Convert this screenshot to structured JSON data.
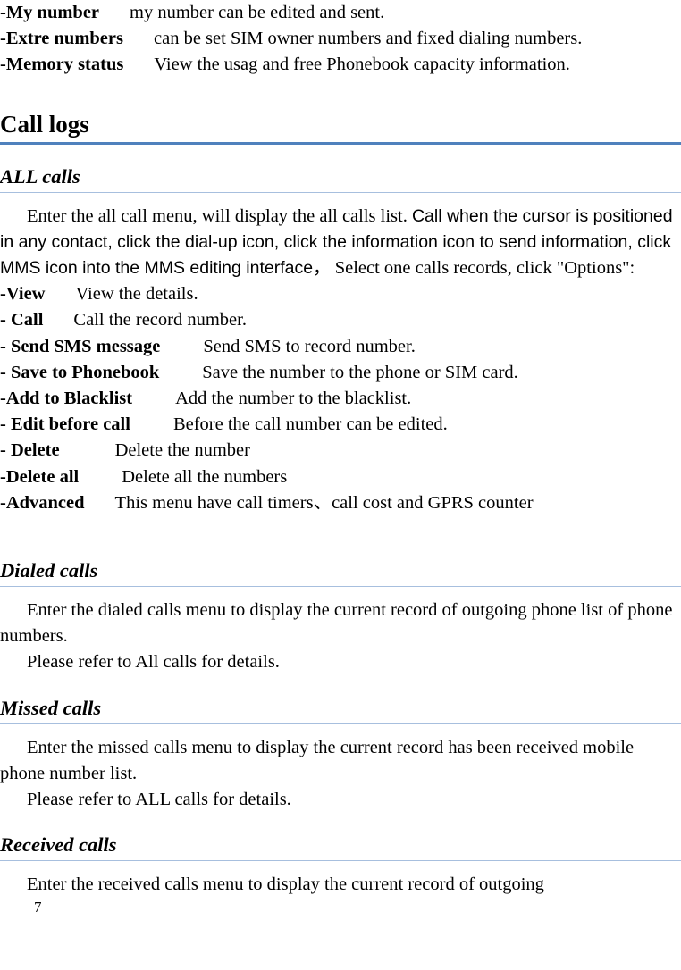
{
  "document": {
    "page_number": "7",
    "accent_color": "#4F81BD",
    "rule_color_light": "#A7BFDE"
  },
  "phonebook_tail": {
    "my_number": {
      "label": "-My number",
      "description": "my number can be edited and sent."
    },
    "extre_numbers": {
      "label": "-Extre numbers",
      "description": "can be set SIM owner numbers and fixed dialing numbers."
    },
    "memory_status": {
      "label": "-Memory status",
      "description": "View the usag and free Phonebook capacity information."
    }
  },
  "call_logs": {
    "heading": "Call logs",
    "all_calls": {
      "heading": "ALL calls",
      "intro_serif_1": "Enter the all call menu, will display the all calls list. ",
      "intro_sans": "Call when the cursor is positioned in any contact, click the dial-up icon, click the information icon to send information, click MMS icon into the MMS editing interface，",
      "intro_serif_2": " Select one calls records, click \"Options\":",
      "options": [
        {
          "label": "-View",
          "description": "View the details."
        },
        {
          "label": "- Call",
          "description": "Call the record number."
        },
        {
          "label": "- Send SMS message",
          "description": "Send SMS to record number."
        },
        {
          "label": "- Save to Phonebook",
          "description": "Save the number to the phone or SIM card."
        },
        {
          "label": "-Add to Blacklist",
          "description": "Add the number to the blacklist."
        },
        {
          "label": "- Edit before call",
          "description": "Before the call number can be edited."
        },
        {
          "label": "- Delete",
          "description": "Delete the number"
        },
        {
          "label": "-Delete all",
          "description": "Delete all the numbers"
        },
        {
          "label": "-Advanced",
          "description": "This menu have call timers、call cost and GPRS counter"
        }
      ]
    },
    "dialed_calls": {
      "heading": "Dialed calls",
      "body": "Enter the dialed calls menu to display the current record of outgoing phone list of phone numbers.",
      "refer": "Please refer to All calls for details."
    },
    "missed_calls": {
      "heading": "Missed calls",
      "body": "Enter the missed calls menu to display the current record has been received mobile phone number list.",
      "refer": "Please refer to ALL calls for details."
    },
    "received_calls": {
      "heading": "Received calls",
      "body": "Enter the received calls menu to display the current record of outgoing"
    }
  }
}
